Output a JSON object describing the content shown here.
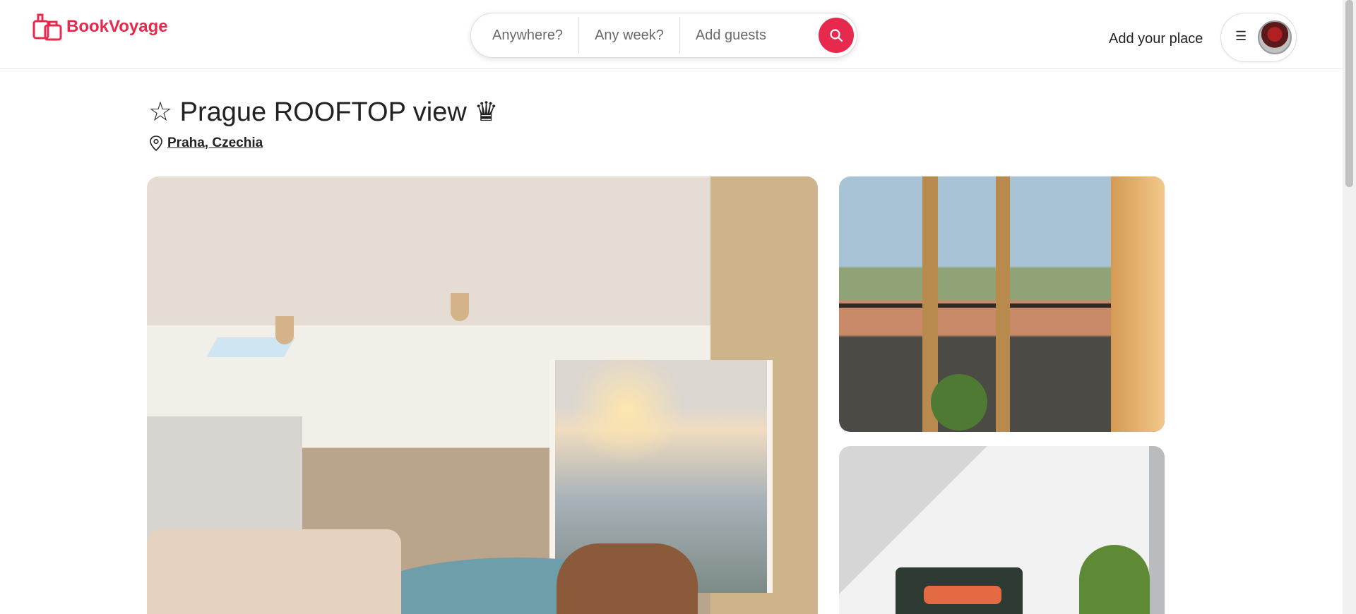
{
  "brand": {
    "name": "BookVoyage",
    "accent": "#e8294e"
  },
  "search": {
    "where": "Anywhere?",
    "when": "Any week?",
    "guests": "Add guests",
    "button_icon": "search-icon"
  },
  "nav": {
    "add_place": "Add your place",
    "menu_icon": "hamburger-icon"
  },
  "listing": {
    "title": "☆ Prague ROOFTOP view ♛",
    "location": "Praha, Czechia",
    "location_icon": "map-pin-icon"
  },
  "photos": [
    {
      "name": "main-living-room-photo"
    },
    {
      "name": "balcony-view-photo"
    },
    {
      "name": "bedroom-photo"
    }
  ]
}
